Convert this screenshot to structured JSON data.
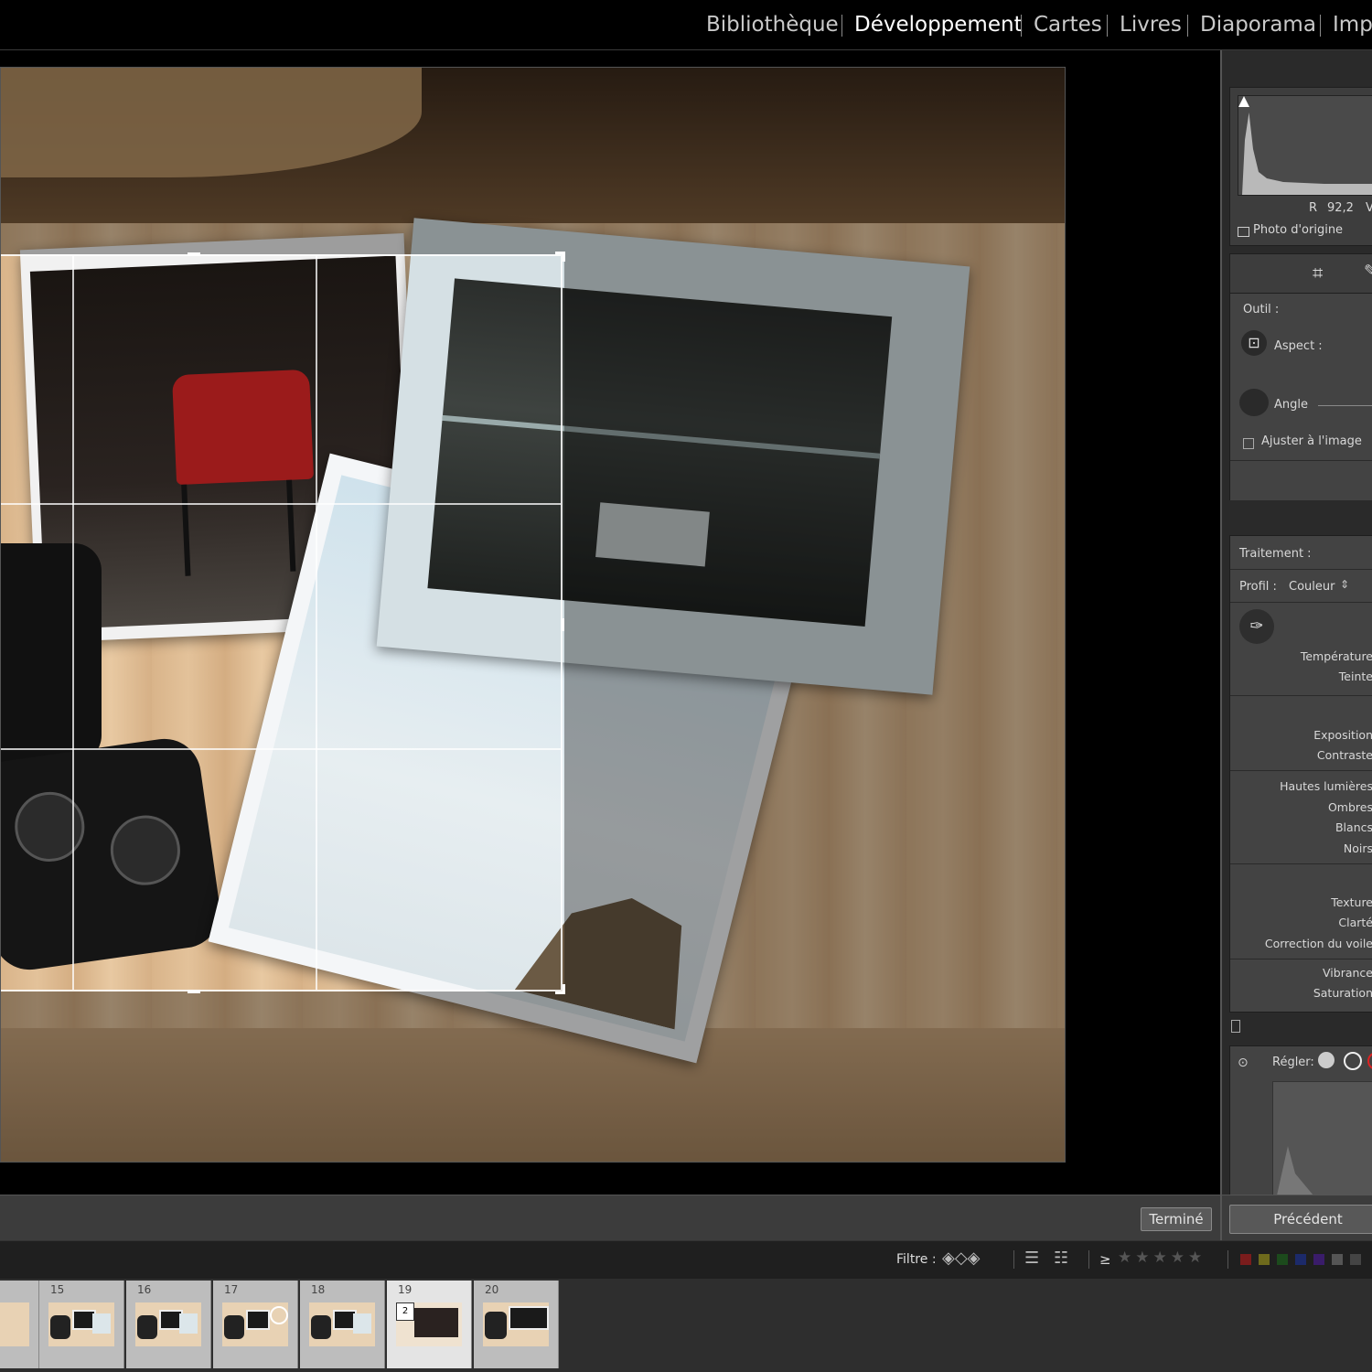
{
  "module_bar": {
    "modules": [
      {
        "label": "Bibliothèque",
        "active": false
      },
      {
        "label": "Développement",
        "active": true
      },
      {
        "label": "Cartes",
        "active": false
      },
      {
        "label": "Livres",
        "active": false
      },
      {
        "label": "Diaporama",
        "active": false
      },
      {
        "label": "Imp",
        "active": false
      }
    ]
  },
  "toolbar": {
    "done_label": "Terminé"
  },
  "histogram": {
    "readout_r_label": "R",
    "readout_value": "92,2",
    "readout_v_label": "V",
    "original_photo_label": "Photo d'origine"
  },
  "crop_panel": {
    "tool_label": "Outil :",
    "aspect_label": "Aspect :",
    "angle_label": "Angle",
    "constrain_label": "Ajuster à l'image"
  },
  "basic_panel": {
    "treatment_label": "Traitement :",
    "profile_label": "Profil :",
    "profile_value": "Couleur",
    "temperature": "Température",
    "tint": "Teinte",
    "exposure": "Exposition",
    "contrast": "Contraste",
    "highlights": "Hautes lumières",
    "shadows": "Ombres",
    "whites": "Blancs",
    "blacks": "Noirs",
    "texture": "Texture",
    "clarity": "Clarté",
    "dehaze": "Correction du voile",
    "vibrance": "Vibrance",
    "saturation": "Saturation"
  },
  "tone_curve": {
    "adjust_label": "Régler:"
  },
  "nav_buttons": {
    "previous_label": "Précédent"
  },
  "filter_bar": {
    "filter_label": "Filtre :",
    "rating_op": "≥"
  },
  "filmstrip": {
    "frames": [
      {
        "number": "",
        "selected": false
      },
      {
        "number": "15",
        "selected": false
      },
      {
        "number": "16",
        "selected": false
      },
      {
        "number": "17",
        "selected": false
      },
      {
        "number": "18",
        "selected": false
      },
      {
        "number": "19",
        "selected": true,
        "badge": "2"
      },
      {
        "number": "20",
        "selected": false
      }
    ]
  },
  "colors": {
    "label_red": "#7a1c1c",
    "label_yellow": "#6e6a1c",
    "label_green": "#1c4a1c",
    "label_blue": "#1c2a6a",
    "label_purple": "#3a1c6a"
  }
}
